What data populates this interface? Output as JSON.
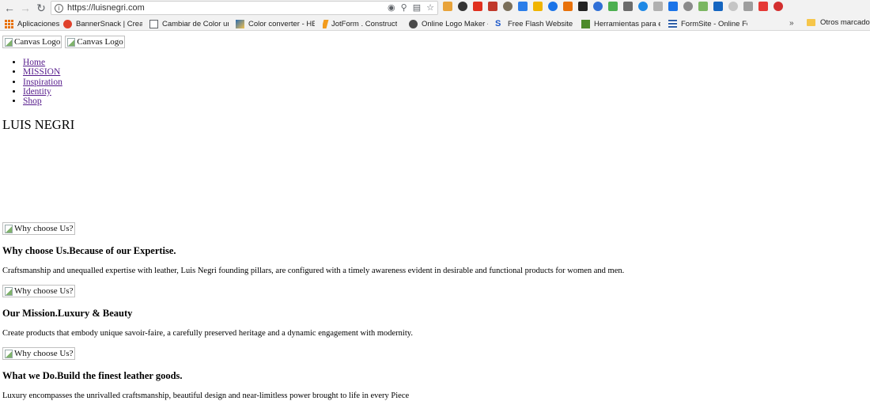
{
  "browser": {
    "url": "https://luisnegri.com",
    "bookmarks": [
      {
        "label": "Aplicaciones",
        "color": "#e8710a"
      },
      {
        "label": "BannerSnack | Creat",
        "color": "#e0412b"
      },
      {
        "label": "Cambiar de Color un",
        "color": "#5f6368"
      },
      {
        "label": "Color converter - HE",
        "color": "#2b6cb0"
      },
      {
        "label": "JotForm . Construct",
        "color": "#f29b1d"
      },
      {
        "label": "Online Logo Maker -",
        "color": "#4a4a4a"
      },
      {
        "label": "Free Flash Website L",
        "color": "#1a56c9"
      },
      {
        "label": "Herramientas para el",
        "color": "#4c8a2b"
      },
      {
        "label": "FormSite - Online For",
        "color": "#2f5fa8"
      }
    ],
    "overflow_label": "»",
    "other_bookmarks": "Otros marcadore",
    "extension_colors": [
      "#e8a33a",
      "#333333",
      "#e0301e",
      "#c0392b",
      "#7a6f5a",
      "#2b7de9",
      "#f0b400",
      "#1a73e8",
      "#e8710a",
      "#222222",
      "#2f6fd6",
      "#4caf50",
      "#6b6b6b",
      "#1e88e5",
      "#b0b0b0",
      "#1a73e8",
      "#8a8a8a",
      "#7bb661",
      "#1565c0",
      "#c5c5c5",
      "#9e9e9e",
      "#e53935",
      "#d32f2f"
    ]
  },
  "page": {
    "logos": [
      "Canvas Logo",
      "Canvas Logo"
    ],
    "menu": [
      "Home",
      "MISSION",
      "Inspiration",
      "Identity",
      "Shop"
    ],
    "brand": "LUIS NEGRI",
    "sections": [
      {
        "img_alt": "Why choose Us?",
        "title": "Why choose Us.Because of our Expertise.",
        "text": "Craftsmanship and unequalled expertise with leather, Luis Negri founding pillars, are configured with a timely awareness evident in desirable and functional products for women and men."
      },
      {
        "img_alt": "Why choose Us?",
        "title": "Our Mission.Luxury & Beauty",
        "text": "Create products that embody unique savoir-faire, a carefully preserved heritage and a dynamic engagement with modernity."
      },
      {
        "img_alt": "Why choose Us?",
        "title": "What we Do.Build the finest leather goods.",
        "text": "Luxury encompasses the unrivalled craftsmanship, beautiful design and near-limitless power brought to life in every Piece"
      }
    ]
  }
}
